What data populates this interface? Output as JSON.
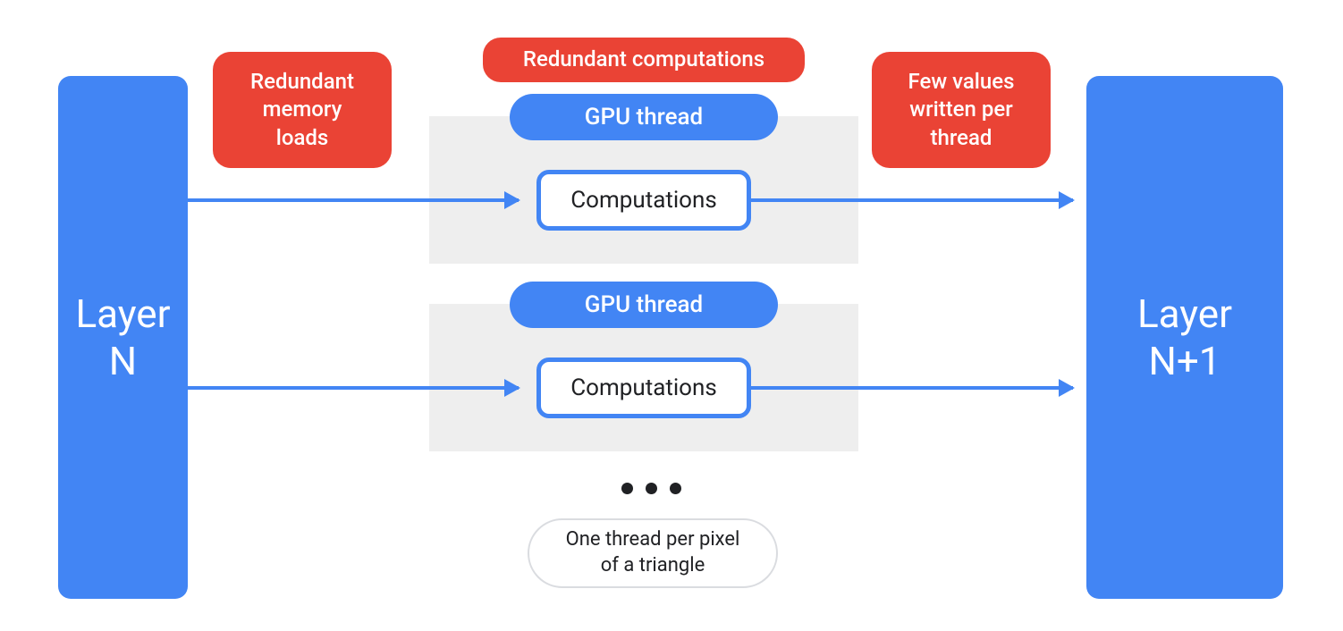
{
  "colors": {
    "blue": "#4285f4",
    "red": "#ea4335",
    "grey": "#eeeeee",
    "text_dark": "#202124"
  },
  "layers": {
    "left": "Layer\nN",
    "right": "Layer\nN+1"
  },
  "callouts": {
    "redundant_memory": "Redundant\nmemory\nloads",
    "redundant_computations": "Redundant computations",
    "few_values": "Few values\nwritten per\nthread"
  },
  "threads": {
    "gpu_thread_label": "GPU thread",
    "computations_label": "Computations"
  },
  "footer": {
    "ellipsis": "•••",
    "note": "One thread per pixel\nof a triangle"
  }
}
